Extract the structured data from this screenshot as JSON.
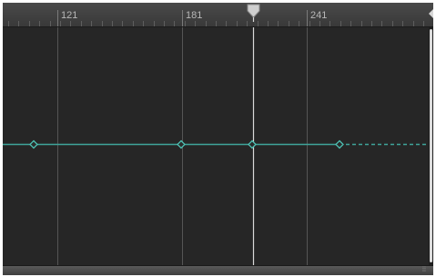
{
  "ruler": {
    "labels": [
      "121",
      "181",
      "241"
    ]
  },
  "playhead": {
    "icon": "playhead-marker-icon"
  },
  "curve": {
    "color": "#3fa39a",
    "keyframe_count": 4
  },
  "scrollbar": {
    "grip_icon": "grip-icon",
    "grip_glyph": "⁞⁞"
  }
}
